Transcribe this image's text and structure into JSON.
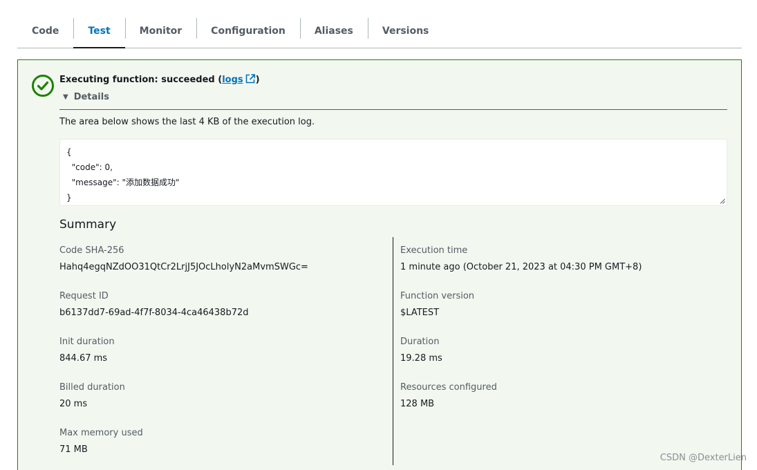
{
  "tabs": [
    {
      "label": "Code"
    },
    {
      "label": "Test"
    },
    {
      "label": "Monitor"
    },
    {
      "label": "Configuration"
    },
    {
      "label": "Aliases"
    },
    {
      "label": "Versions"
    }
  ],
  "active_tab": "Test",
  "status": {
    "prefix": "Executing function: succeeded (",
    "link_label": "logs",
    "suffix": ")",
    "color": "#1d8102"
  },
  "details": {
    "label": "Details",
    "caption": "The area below shows the last 4 KB of the execution log.",
    "log_text": "{\n  \"code\": 0,\n  \"message\": \"添加数据成功\"\n}"
  },
  "summary": {
    "title": "Summary",
    "left": [
      {
        "key": "Code SHA-256",
        "value": "Hahq4egqNZdOO31QtCr2LrjJ5JOcLholyN2aMvmSWGc="
      },
      {
        "key": "Request ID",
        "value": "b6137dd7-69ad-4f7f-8034-4ca46438b72d"
      },
      {
        "key": "Init duration",
        "value": "844.67 ms"
      },
      {
        "key": "Billed duration",
        "value": "20 ms"
      },
      {
        "key": "Max memory used",
        "value": "71 MB"
      }
    ],
    "right": [
      {
        "key": "Execution time",
        "value": "1 minute ago (October 21, 2023 at 04:30 PM GMT+8)"
      },
      {
        "key": "Function version",
        "value": "$LATEST"
      },
      {
        "key": "Duration",
        "value": "19.28 ms"
      },
      {
        "key": "Resources configured",
        "value": "128 MB"
      }
    ]
  },
  "watermark": "CSDN @DexterLien"
}
